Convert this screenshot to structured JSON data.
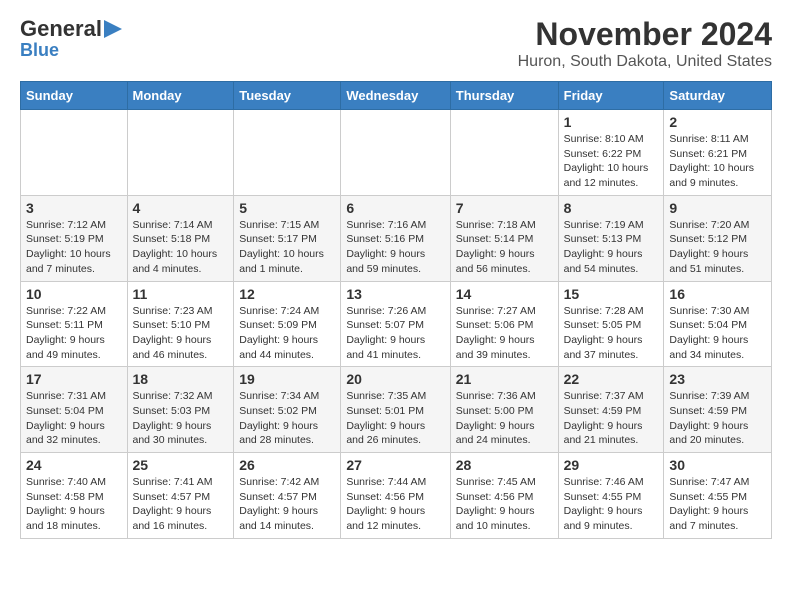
{
  "header": {
    "logo_general": "General",
    "logo_blue": "Blue",
    "month_title": "November 2024",
    "location": "Huron, South Dakota, United States"
  },
  "weekdays": [
    "Sunday",
    "Monday",
    "Tuesday",
    "Wednesday",
    "Thursday",
    "Friday",
    "Saturday"
  ],
  "weeks": [
    [
      {
        "day": "",
        "info": ""
      },
      {
        "day": "",
        "info": ""
      },
      {
        "day": "",
        "info": ""
      },
      {
        "day": "",
        "info": ""
      },
      {
        "day": "",
        "info": ""
      },
      {
        "day": "1",
        "info": "Sunrise: 8:10 AM\nSunset: 6:22 PM\nDaylight: 10 hours and 12 minutes."
      },
      {
        "day": "2",
        "info": "Sunrise: 8:11 AM\nSunset: 6:21 PM\nDaylight: 10 hours and 9 minutes."
      }
    ],
    [
      {
        "day": "3",
        "info": "Sunrise: 7:12 AM\nSunset: 5:19 PM\nDaylight: 10 hours and 7 minutes."
      },
      {
        "day": "4",
        "info": "Sunrise: 7:14 AM\nSunset: 5:18 PM\nDaylight: 10 hours and 4 minutes."
      },
      {
        "day": "5",
        "info": "Sunrise: 7:15 AM\nSunset: 5:17 PM\nDaylight: 10 hours and 1 minute."
      },
      {
        "day": "6",
        "info": "Sunrise: 7:16 AM\nSunset: 5:16 PM\nDaylight: 9 hours and 59 minutes."
      },
      {
        "day": "7",
        "info": "Sunrise: 7:18 AM\nSunset: 5:14 PM\nDaylight: 9 hours and 56 minutes."
      },
      {
        "day": "8",
        "info": "Sunrise: 7:19 AM\nSunset: 5:13 PM\nDaylight: 9 hours and 54 minutes."
      },
      {
        "day": "9",
        "info": "Sunrise: 7:20 AM\nSunset: 5:12 PM\nDaylight: 9 hours and 51 minutes."
      }
    ],
    [
      {
        "day": "10",
        "info": "Sunrise: 7:22 AM\nSunset: 5:11 PM\nDaylight: 9 hours and 49 minutes."
      },
      {
        "day": "11",
        "info": "Sunrise: 7:23 AM\nSunset: 5:10 PM\nDaylight: 9 hours and 46 minutes."
      },
      {
        "day": "12",
        "info": "Sunrise: 7:24 AM\nSunset: 5:09 PM\nDaylight: 9 hours and 44 minutes."
      },
      {
        "day": "13",
        "info": "Sunrise: 7:26 AM\nSunset: 5:07 PM\nDaylight: 9 hours and 41 minutes."
      },
      {
        "day": "14",
        "info": "Sunrise: 7:27 AM\nSunset: 5:06 PM\nDaylight: 9 hours and 39 minutes."
      },
      {
        "day": "15",
        "info": "Sunrise: 7:28 AM\nSunset: 5:05 PM\nDaylight: 9 hours and 37 minutes."
      },
      {
        "day": "16",
        "info": "Sunrise: 7:30 AM\nSunset: 5:04 PM\nDaylight: 9 hours and 34 minutes."
      }
    ],
    [
      {
        "day": "17",
        "info": "Sunrise: 7:31 AM\nSunset: 5:04 PM\nDaylight: 9 hours and 32 minutes."
      },
      {
        "day": "18",
        "info": "Sunrise: 7:32 AM\nSunset: 5:03 PM\nDaylight: 9 hours and 30 minutes."
      },
      {
        "day": "19",
        "info": "Sunrise: 7:34 AM\nSunset: 5:02 PM\nDaylight: 9 hours and 28 minutes."
      },
      {
        "day": "20",
        "info": "Sunrise: 7:35 AM\nSunset: 5:01 PM\nDaylight: 9 hours and 26 minutes."
      },
      {
        "day": "21",
        "info": "Sunrise: 7:36 AM\nSunset: 5:00 PM\nDaylight: 9 hours and 24 minutes."
      },
      {
        "day": "22",
        "info": "Sunrise: 7:37 AM\nSunset: 4:59 PM\nDaylight: 9 hours and 21 minutes."
      },
      {
        "day": "23",
        "info": "Sunrise: 7:39 AM\nSunset: 4:59 PM\nDaylight: 9 hours and 20 minutes."
      }
    ],
    [
      {
        "day": "24",
        "info": "Sunrise: 7:40 AM\nSunset: 4:58 PM\nDaylight: 9 hours and 18 minutes."
      },
      {
        "day": "25",
        "info": "Sunrise: 7:41 AM\nSunset: 4:57 PM\nDaylight: 9 hours and 16 minutes."
      },
      {
        "day": "26",
        "info": "Sunrise: 7:42 AM\nSunset: 4:57 PM\nDaylight: 9 hours and 14 minutes."
      },
      {
        "day": "27",
        "info": "Sunrise: 7:44 AM\nSunset: 4:56 PM\nDaylight: 9 hours and 12 minutes."
      },
      {
        "day": "28",
        "info": "Sunrise: 7:45 AM\nSunset: 4:56 PM\nDaylight: 9 hours and 10 minutes."
      },
      {
        "day": "29",
        "info": "Sunrise: 7:46 AM\nSunset: 4:55 PM\nDaylight: 9 hours and 9 minutes."
      },
      {
        "day": "30",
        "info": "Sunrise: 7:47 AM\nSunset: 4:55 PM\nDaylight: 9 hours and 7 minutes."
      }
    ]
  ]
}
